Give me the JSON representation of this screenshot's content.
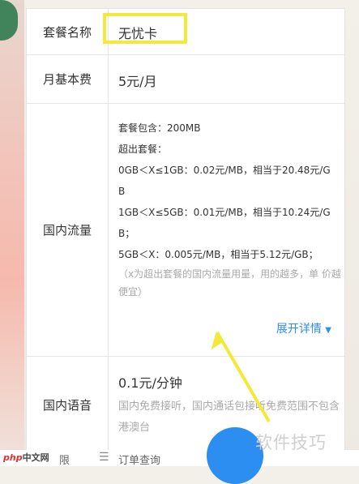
{
  "plan": {
    "name_label": "套餐名称",
    "name_value": "无忧卡",
    "fee_label": "月基本费",
    "fee_value": "5元/月",
    "data_label": "国内流量",
    "data_lines": [
      "套餐包含：200MB",
      "超出套餐：",
      "0GB＜X≤1GB：0.02元/MB，相当于20.48元/G",
      "B",
      "1GB＜X≤5GB：0.01元/MB，相当于10.24元/G",
      "B；",
      "5GB＜X：0.005元/MB，相当于5.12元/GB；"
    ],
    "data_note": "（x为超出套餐的国内流量用量，用的越多，单 价越便宜）",
    "expand_label": "展开详情",
    "voice_label": "国内语音",
    "voice_value": "0.1元/分钟",
    "voice_sub": "国内免费接听，国内通话包接听免费范围不包含港澳台"
  },
  "bottom": {
    "left_tab_partial": "限",
    "order_query": "订单查询"
  },
  "watermark": {
    "left_php": "php",
    "left_cn": "中文网",
    "right": "软件技巧"
  },
  "colors": {
    "accent": "#2f8ee6",
    "highlight": "#f3e93a",
    "fab": "#2b8ef0"
  }
}
